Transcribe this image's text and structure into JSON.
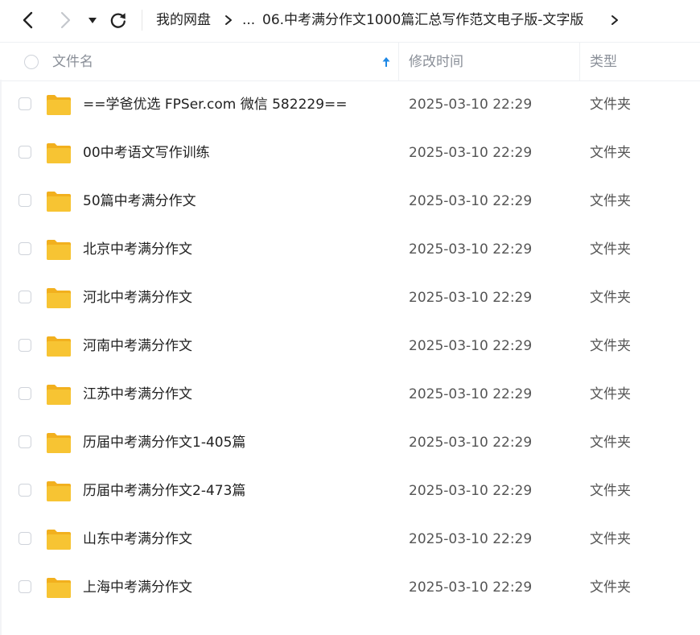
{
  "toolbar": {
    "breadcrumb": {
      "root": "我的网盘",
      "ellipsis": "...",
      "current": "06.中考满分作文1000篇汇总写作范文电子版-文字版"
    }
  },
  "table": {
    "columns": {
      "name": "文件名",
      "modified": "修改时间",
      "type": "类型"
    },
    "sort": {
      "column": "name",
      "direction": "ascending"
    },
    "rows": [
      {
        "name": "==学爸优选 FPSer.com 微信 582229==",
        "modified": "2025-03-10 22:29",
        "type": "文件夹"
      },
      {
        "name": "00中考语文写作训练",
        "modified": "2025-03-10 22:29",
        "type": "文件夹"
      },
      {
        "name": "50篇中考满分作文",
        "modified": "2025-03-10 22:29",
        "type": "文件夹"
      },
      {
        "name": "北京中考满分作文",
        "modified": "2025-03-10 22:29",
        "type": "文件夹"
      },
      {
        "name": "河北中考满分作文",
        "modified": "2025-03-10 22:29",
        "type": "文件夹"
      },
      {
        "name": "河南中考满分作文",
        "modified": "2025-03-10 22:29",
        "type": "文件夹"
      },
      {
        "name": "江苏中考满分作文",
        "modified": "2025-03-10 22:29",
        "type": "文件夹"
      },
      {
        "name": "历届中考满分作文1-405篇",
        "modified": "2025-03-10 22:29",
        "type": "文件夹"
      },
      {
        "name": "历届中考满分作文2-473篇",
        "modified": "2025-03-10 22:29",
        "type": "文件夹"
      },
      {
        "name": "山东中考满分作文",
        "modified": "2025-03-10 22:29",
        "type": "文件夹"
      },
      {
        "name": "上海中考满分作文",
        "modified": "2025-03-10 22:29",
        "type": "文件夹"
      }
    ]
  },
  "colors": {
    "accent": "#1e88e5",
    "folder": "#f7c433",
    "folder_tab": "#f2b01e"
  },
  "icons": {
    "back": "chevron-left-icon",
    "forward": "chevron-right-icon",
    "dropdown": "caret-down-icon",
    "refresh": "refresh-icon",
    "breadcrumb_separator": "chevron-right-icon",
    "sort": "arrow-up-icon",
    "folder": "folder-icon"
  }
}
